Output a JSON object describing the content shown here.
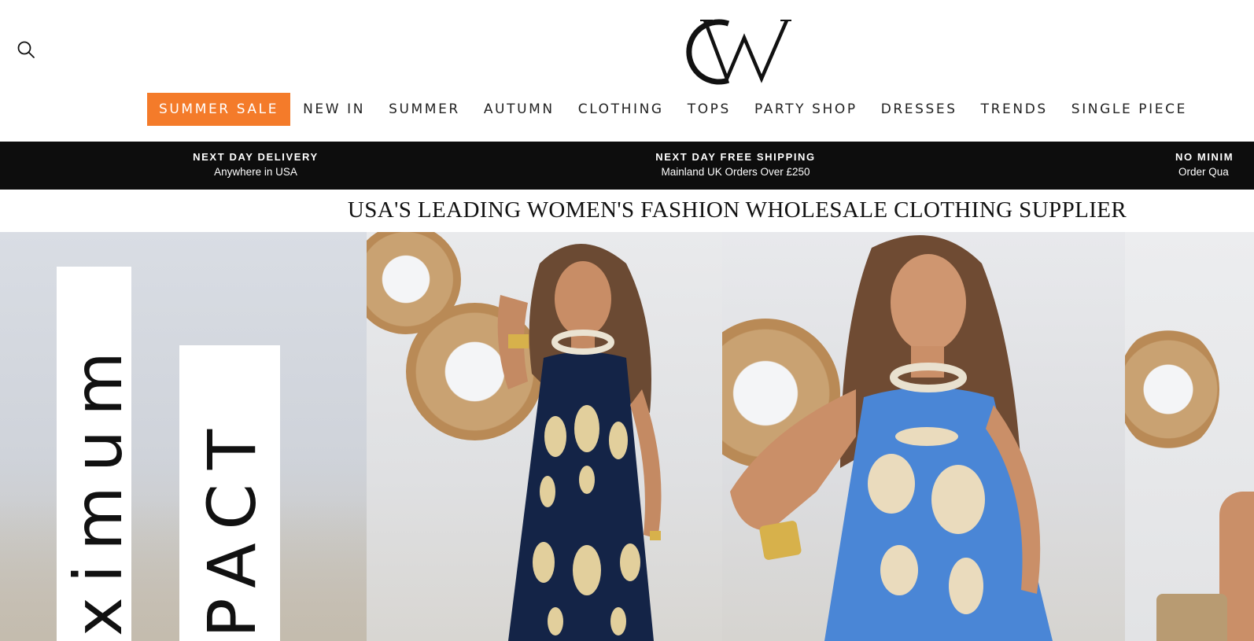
{
  "header": {
    "logo_text": "CW",
    "search_icon": "search-icon"
  },
  "nav": {
    "items": [
      {
        "label": "SUMMER SALE",
        "highlight": true
      },
      {
        "label": "NEW IN"
      },
      {
        "label": "SUMMER"
      },
      {
        "label": "AUTUMN"
      },
      {
        "label": "CLOTHING"
      },
      {
        "label": "TOPS"
      },
      {
        "label": "PARTY SHOP"
      },
      {
        "label": "DRESSES"
      },
      {
        "label": "TRENDS"
      },
      {
        "label": "SINGLE PIECE"
      }
    ],
    "sale_color": "#f47b2a"
  },
  "usp": [
    {
      "title": "NEXT DAY DELIVERY",
      "subtitle": "Anywhere in USA"
    },
    {
      "title": "NEXT DAY FREE SHIPPING",
      "subtitle": "Mainland UK Orders Over £250"
    },
    {
      "title": "NO MINIM",
      "subtitle": "Order Qua"
    }
  ],
  "tagline": "USA'S LEADING WOMEN'S FASHION WHOLESALE CLOTHING SUPPLIER",
  "hero": {
    "card1_text": "ximum",
    "card2_text": "PACT",
    "dress_colors": {
      "navy": "#142447",
      "blue": "#4a86d6",
      "pattern": "#e2cf9c"
    }
  }
}
